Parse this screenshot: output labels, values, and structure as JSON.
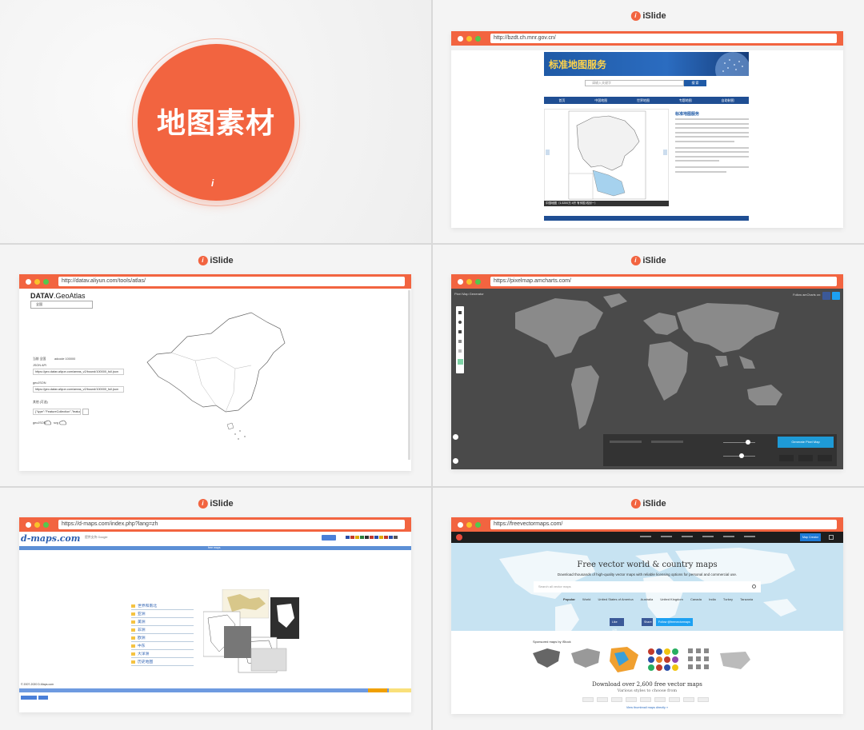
{
  "cover": {
    "title": "地图素材",
    "mark": "i"
  },
  "logo": {
    "text": "iSlide",
    "icon": "i"
  },
  "panels": {
    "tianditu": {
      "url": "http://bzdt.ch.mnr.gov.cn/",
      "banner": "标准地图服务",
      "search_placeholder": "请输入关键字",
      "search_btn": "搜 索",
      "nav": [
        "首页",
        "中国地图",
        "世界地图",
        "专题地图",
        "自助制图"
      ],
      "side_title": "标准地图服务",
      "caption": "中国地图（1:3200万 4开 有邻国 线划一）"
    },
    "datav": {
      "url": "http://datav.aliyun.com/tools/atlas/",
      "brand": "DATAV",
      "title_suffix": ".GeoAtlas",
      "search_value": "全国",
      "label_current": "当前 全国",
      "label_adcode": "adcode 100000",
      "label_json": "JSON API",
      "field_json": "https://geo.datav.aliyun.com/areas_v2/bound/100000_full.json",
      "label_geojson": "geoJSON",
      "field_geojson": "https://geo.datav.aliyun.com/areas_v2/bound/100000_full.json",
      "label_bounds": "其他 (可选)",
      "field_bounds": "{\"type\":\"FeatureCollection\",\"features\":[",
      "label_download": "geoJSON",
      "label_svg": "svg"
    },
    "pixelmap": {
      "url": "https://pixelmap.amcharts.com/",
      "brand": "Pixel Map Generator",
      "follow": "Follow amCharts on:",
      "generate": "Generate Pixel Map"
    },
    "dmaps": {
      "url": "https://d-maps.com/index.php?lang=zh",
      "logo": "d-maps.com",
      "google": "提供支持 Google",
      "bar_label": "free maps",
      "list": [
        "世界和南北",
        "亚洲",
        "美洲",
        "非洲",
        "欧洲",
        "中东",
        "大洋洲",
        "历史地图"
      ],
      "copyright": "© 2007-2020 D-Maps.com"
    },
    "freevector": {
      "url": "https://freevectormaps.com/",
      "title": "Free vector world & country maps",
      "subtitle": "Download thousands of high-quality vector maps with reliable licensing options for personal and commercial use.",
      "search_placeholder": "Search all vector maps",
      "popular": "Popular",
      "popular_items": [
        "World",
        "United States of America",
        "Australia",
        "United Kingdom",
        "Canada",
        "India",
        "Turkey",
        "Tanzania"
      ],
      "like": "Like 12K",
      "share": "Share",
      "follow": "Follow @freevectormaps",
      "map_creator": "Map Creator",
      "sponsored": "Sponsored maps by iStock",
      "download": "Download over 2,600 free vector maps",
      "styles": "Various styles to choose from",
      "more": "View thumbnail maps directly »"
    }
  }
}
